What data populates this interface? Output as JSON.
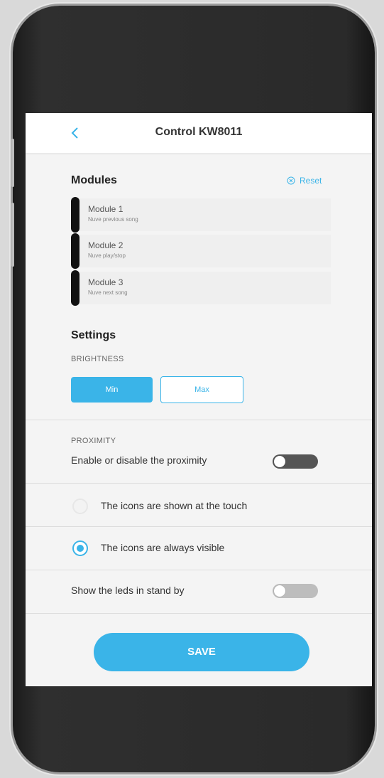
{
  "header": {
    "title": "Control KW8011",
    "back_icon": "chevron-left-icon"
  },
  "modules": {
    "title": "Modules",
    "reset_label": "Reset",
    "reset_icon": "close-circle-icon",
    "items": [
      {
        "name": "Module 1",
        "desc": "Nuve previous song"
      },
      {
        "name": "Module 2",
        "desc": "Nuve play/stop"
      },
      {
        "name": "Module 3",
        "desc": "Nuve next song"
      }
    ]
  },
  "settings": {
    "title": "Settings",
    "brightness": {
      "label": "BRIGHTNESS",
      "min_label": "Min",
      "max_label": "Max",
      "selected": "Min"
    },
    "proximity": {
      "label": "PROXIMITY",
      "toggle_label": "Enable or disable the proximity",
      "enabled": false
    },
    "icons_options": [
      {
        "label": "The icons are shown at the touch",
        "selected": false
      },
      {
        "label": "The icons are always visible",
        "selected": true
      }
    ],
    "leds": {
      "label": "Show the leds in stand by",
      "enabled": false
    }
  },
  "save_label": "SAVE",
  "colors": {
    "accent": "#3ab4e8",
    "module_bar": "#111111",
    "background": "#f4f4f4"
  }
}
